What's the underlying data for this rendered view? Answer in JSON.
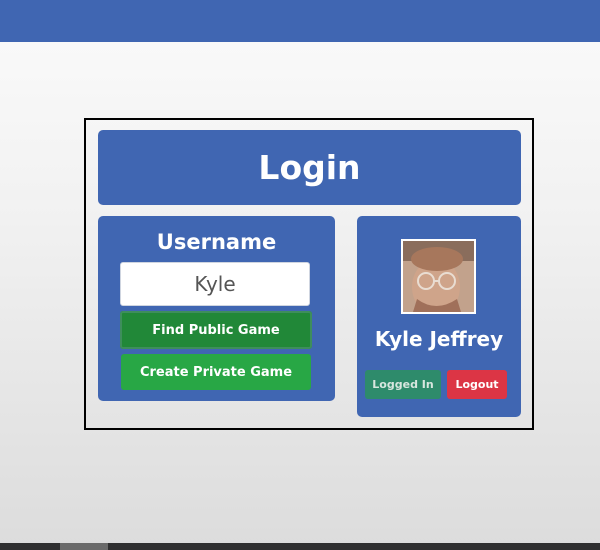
{
  "header": {
    "title": "Login"
  },
  "login_form": {
    "label": "Username",
    "input_value": "Kyle",
    "find_button": "Find Public Game",
    "create_button": "Create Private Game"
  },
  "profile": {
    "name": "Kyle Jeffrey",
    "avatar_icon": "user-photo",
    "status_button": "Logged In",
    "logout_button": "Logout"
  },
  "colors": {
    "primary": "#4066b2",
    "success": "#28a745",
    "success_dark": "#218838",
    "danger": "#dc3545",
    "teal": "#2e8b6b"
  }
}
